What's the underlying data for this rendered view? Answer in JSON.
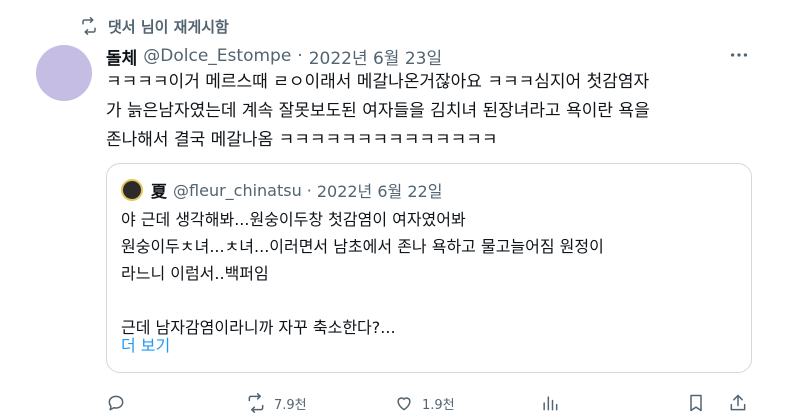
{
  "retweet": {
    "text": "댓서 님이 재게시함"
  },
  "tweet": {
    "display_name": "돌체",
    "handle": "@Dolce_Estompe",
    "separator": "·",
    "date": "2022년 6월 23일",
    "text": "ㅋㅋㅋㅋ이거 메르스때 ㄹㅇ이래서 메갈나온거잖아요 ㅋㅋㅋ심지어 첫감염자\n가 늙은남자였는데 계속 잘못보도된 여자들을 김치녀 된장녀라고 욕이란 욕을\n존나해서 결국 메갈나옴 ㅋㅋㅋㅋㅋㅋㅋㅋㅋㅋㅋㅋㅋㅋ"
  },
  "quote": {
    "display_name": "夏",
    "handle": "@fleur_chinatsu",
    "separator": "·",
    "date": "2022년 6월 22일",
    "text": "야 근데 생각해봐...원숭이두창 첫감염이 여자였어봐\n원숭이두ㅊ녀...ㅊ녀...이러면서 남초에서 존나 욕하고 물고늘어짐 원정이\n라느니 이럼서..백퍼임\n\n근데 남자감염이라니까 자꾸 축소한다?...",
    "show_more": "더 보기"
  },
  "actions": {
    "reply_count": "",
    "retweet_count": "7.9천",
    "like_count": "1.9천"
  },
  "colors": {
    "accent": "#1d9bf0",
    "muted": "#536471",
    "avatar": "#c6bde4"
  }
}
